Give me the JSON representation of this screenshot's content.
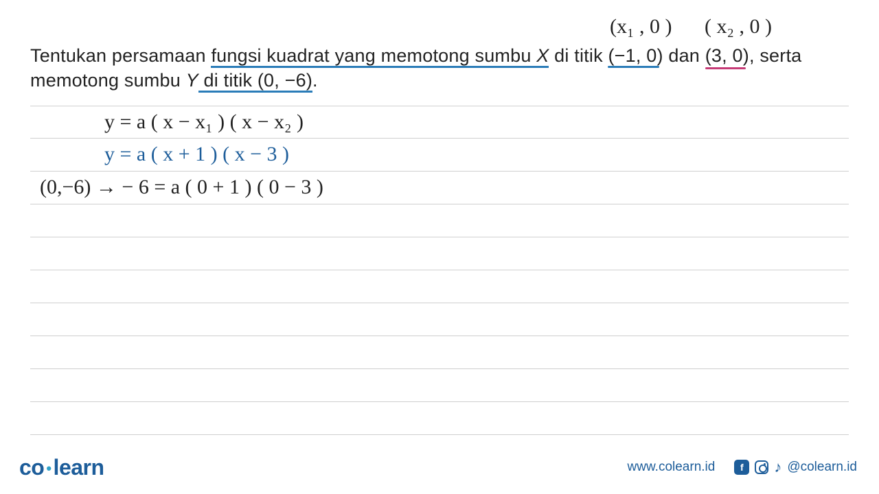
{
  "annotations": {
    "x1": "(x₁ , 0 )",
    "x2": "( x₂ , 0 )"
  },
  "question": {
    "part1_a": "Tentukan persamaan ",
    "part1_b": "fungsi kuadrat yang memotong sumbu ",
    "part1_c": "X",
    "part1_d": " di titik ",
    "pt1": "(−1, 0)",
    "part1_e": " dan ",
    "pt2": "(3, 0)",
    "part1_f": ", serta",
    "part2_a": "memotong sumbu ",
    "part2_b": "Y",
    "part2_c": " di titik (0, −6)",
    "part2_d": "."
  },
  "work": {
    "line1": "y  =  a ( x − x₁ ) ( x  − x₂ )",
    "line2": "y =  a (  x + 1 ) (  x  −  3 )",
    "line3": "(0,−6) →  − 6  =   a (  0 + 1 ) (  0 − 3 )"
  },
  "footer": {
    "logo_co": "co",
    "logo_learn": "learn",
    "url": "www.colearn.id",
    "handle": "@colearn.id",
    "fb": "f",
    "tiktok": "♪"
  }
}
